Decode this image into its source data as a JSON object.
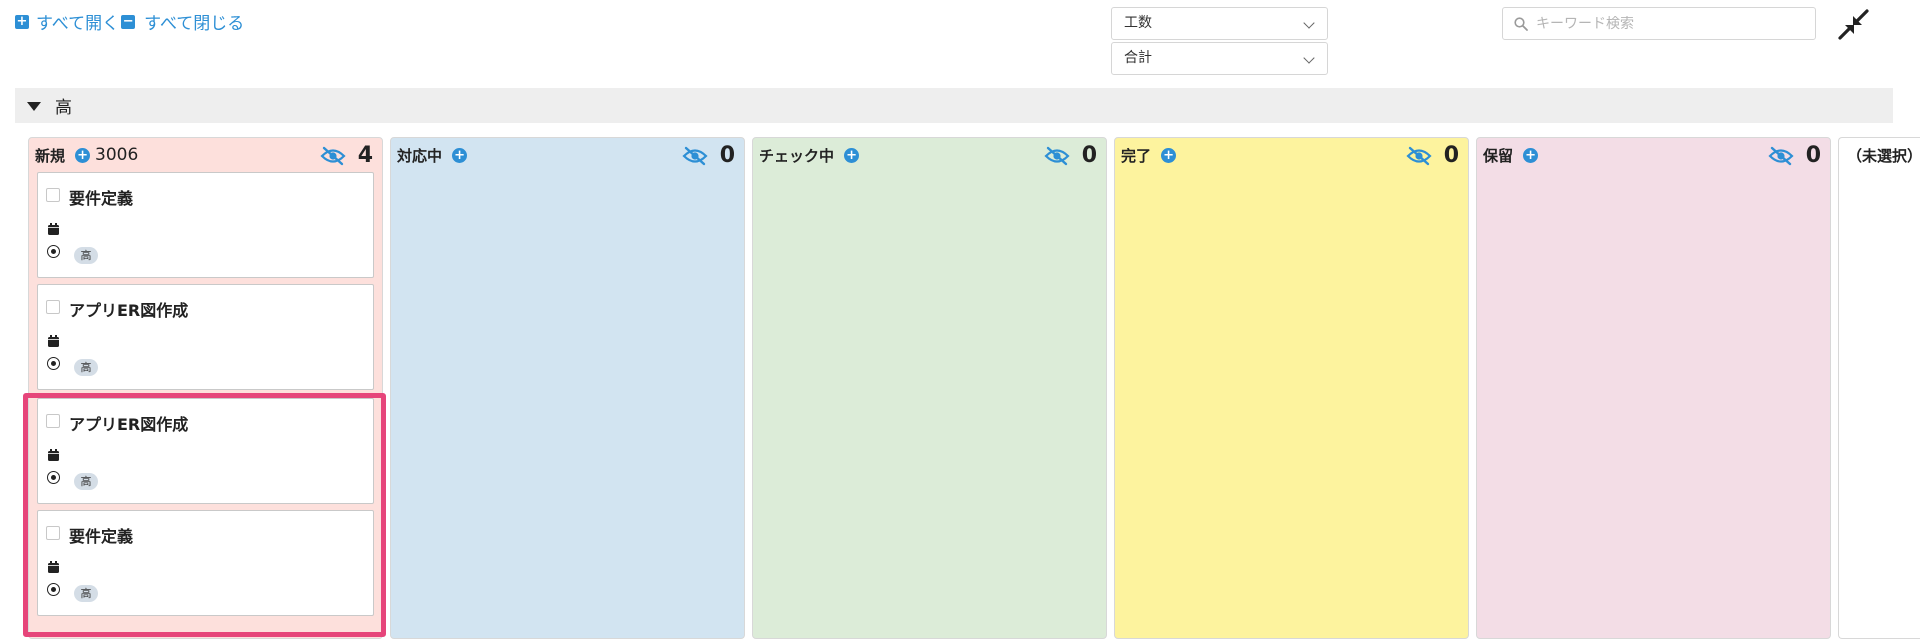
{
  "toolbar": {
    "expand_all_label": "すべて開く",
    "collapse_all_label": "すべて閉じる",
    "select_1_value": "工数",
    "select_2_value": "合計",
    "search_placeholder": "キーワード検索"
  },
  "group": {
    "label": "高"
  },
  "columns": [
    {
      "name": "新規",
      "extra": "3006",
      "count": "4",
      "bg": "#fde0dc"
    },
    {
      "name": "対応中",
      "extra": "",
      "count": "0",
      "bg": "#d2e4f1"
    },
    {
      "name": "チェック中",
      "extra": "",
      "count": "0",
      "bg": "#dcecd8"
    },
    {
      "name": "完了",
      "extra": "",
      "count": "0",
      "bg": "#fdf39e"
    },
    {
      "name": "保留",
      "extra": "",
      "count": "0",
      "bg": "#f3dde6"
    },
    {
      "name": "（未選択）",
      "extra": "",
      "count": "",
      "bg": "#ffffff"
    }
  ],
  "cards": [
    {
      "title": "要件定義",
      "priority": "高"
    },
    {
      "title": "アプリER図作成",
      "priority": "高"
    },
    {
      "title": "アプリER図作成",
      "priority": "高"
    },
    {
      "title": "要件定義",
      "priority": "高"
    }
  ],
  "colors": {
    "accent": "#2d8fd5",
    "highlight": "#e6457a"
  }
}
